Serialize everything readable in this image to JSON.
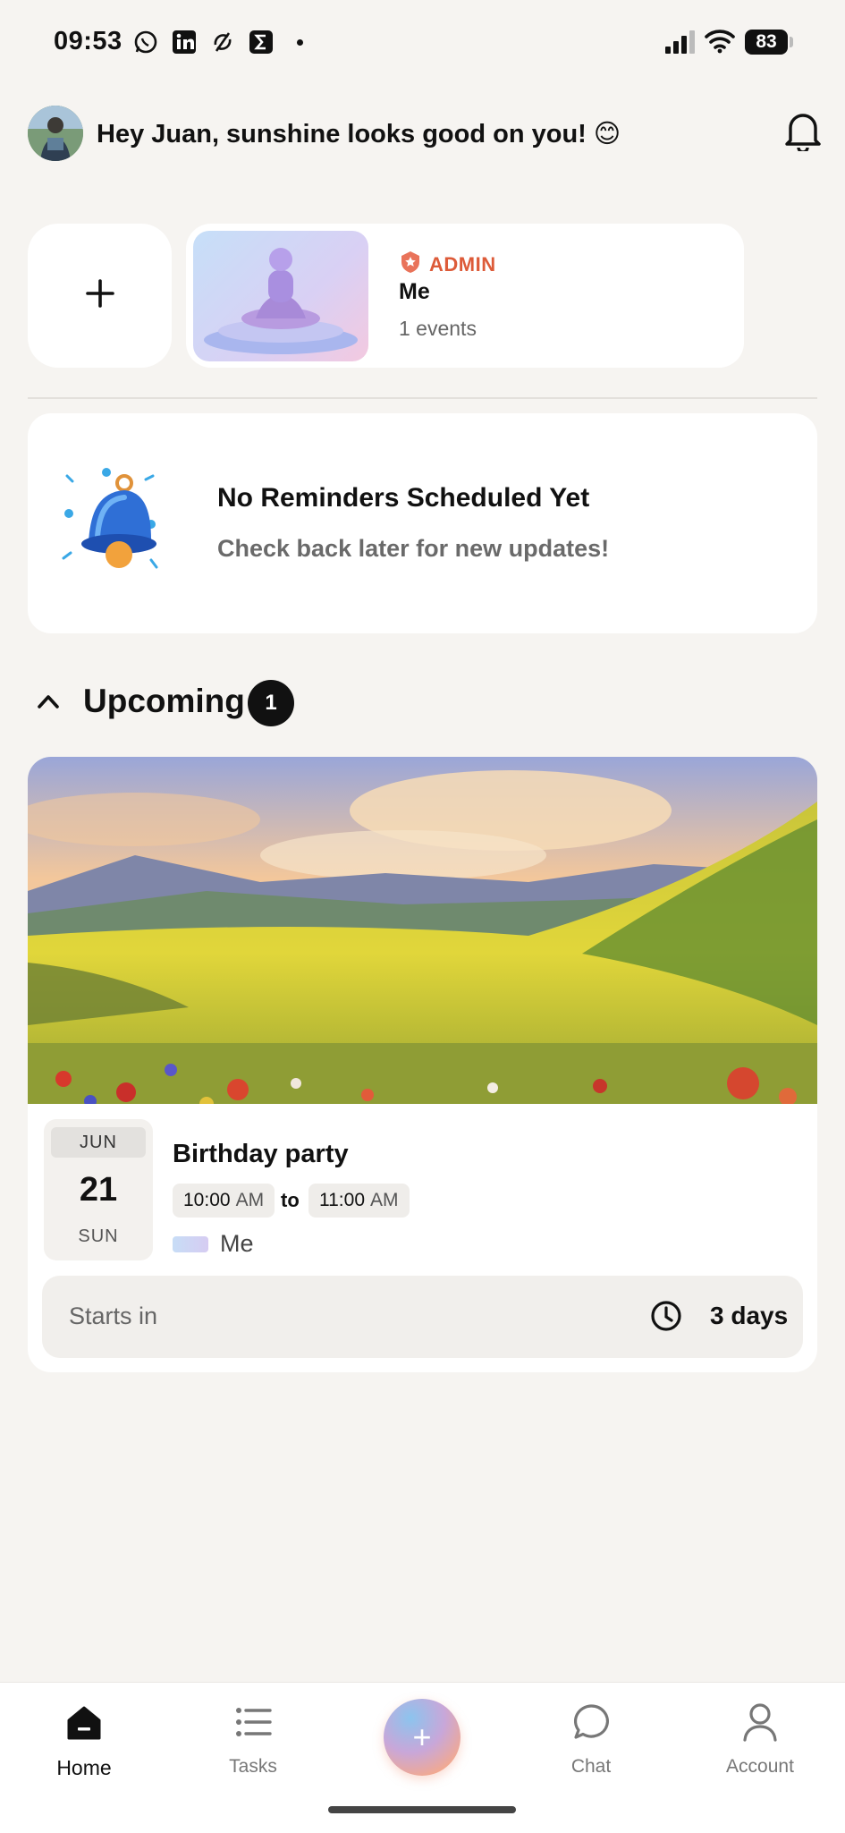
{
  "status_bar": {
    "time": "09:53",
    "notification_icons": [
      "whatsapp-icon",
      "linkedin-icon",
      "sync-icon",
      "sigma-app-icon"
    ],
    "battery": "83"
  },
  "header": {
    "greeting": "Hey Juan, sunshine looks good on you! 😊"
  },
  "spaces": [
    {
      "role": "ADMIN",
      "name": "Me",
      "events": "1 events"
    }
  ],
  "reminders": {
    "title": "No Reminders Scheduled Yet",
    "subtitle": "Check back later for new updates!"
  },
  "upcoming": {
    "title": "Upcoming",
    "count": "1",
    "events": [
      {
        "month": "JUN",
        "day": "21",
        "weekday": "SUN",
        "title": "Birthday party",
        "start": "10:00",
        "start_ampm": "AM",
        "to": "to",
        "end": "11:00",
        "end_ampm": "AM",
        "space": "Me",
        "starts_in_label": "Starts in",
        "starts_in_value": "3 days"
      }
    ]
  },
  "bottom_nav": {
    "items": [
      "Home",
      "Tasks",
      "Chat",
      "Account"
    ],
    "active": "Home",
    "fab_label": "+"
  },
  "colors": {
    "background": "#f6f4f1",
    "admin_accent": "#dd5b39",
    "text": "#111111"
  }
}
